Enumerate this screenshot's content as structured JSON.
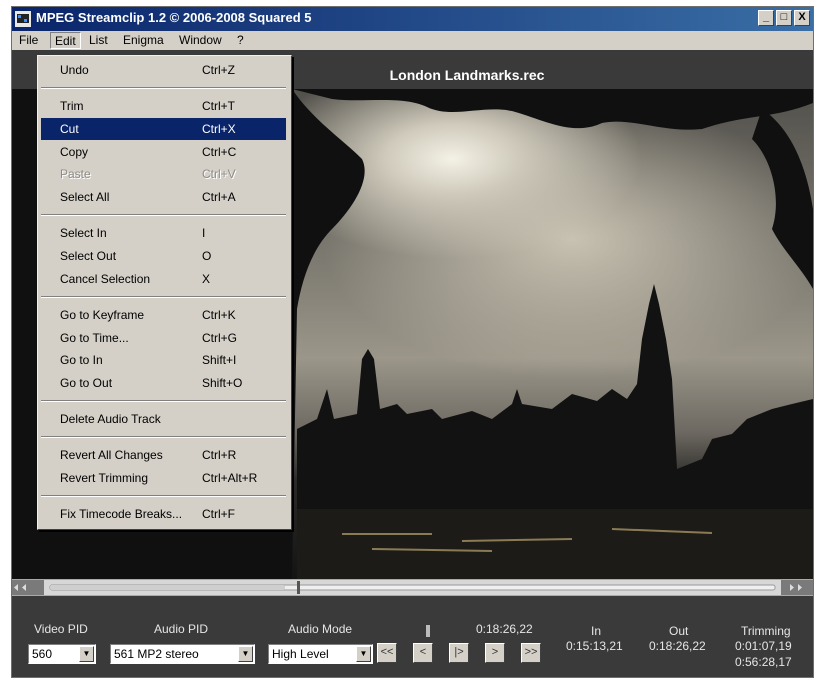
{
  "window": {
    "title": "MPEG Streamclip 1.2  ©  2006-2008 Squared 5",
    "buttons": [
      "_",
      "□",
      "X"
    ]
  },
  "menubar": [
    "File",
    "Edit",
    "List",
    "Enigma",
    "Window",
    "?"
  ],
  "file_title": "London Landmarks.rec",
  "edit_menu": {
    "groups": [
      [
        {
          "label": "Undo",
          "shortcut": "Ctrl+Z"
        }
      ],
      [
        {
          "label": "Trim",
          "shortcut": "Ctrl+T"
        },
        {
          "label": "Cut",
          "shortcut": "Ctrl+X",
          "highlighted": true
        },
        {
          "label": "Copy",
          "shortcut": "Ctrl+C"
        },
        {
          "label": "Paste",
          "shortcut": "Ctrl+V",
          "disabled": true
        },
        {
          "label": "Select All",
          "shortcut": "Ctrl+A"
        }
      ],
      [
        {
          "label": "Select In",
          "shortcut": "I"
        },
        {
          "label": "Select Out",
          "shortcut": "O"
        },
        {
          "label": "Cancel Selection",
          "shortcut": "X"
        }
      ],
      [
        {
          "label": "Go to Keyframe",
          "shortcut": "Ctrl+K"
        },
        {
          "label": "Go to Time...",
          "shortcut": "Ctrl+G"
        },
        {
          "label": "Go to In",
          "shortcut": "Shift+I"
        },
        {
          "label": "Go to Out",
          "shortcut": "Shift+O"
        }
      ],
      [
        {
          "label": "Delete Audio Track",
          "shortcut": ""
        }
      ],
      [
        {
          "label": "Revert All Changes",
          "shortcut": "Ctrl+R"
        },
        {
          "label": "Revert Trimming",
          "shortcut": "Ctrl+Alt+R"
        }
      ],
      [
        {
          "label": "Fix Timecode Breaks...",
          "shortcut": "Ctrl+F"
        }
      ]
    ]
  },
  "controls": {
    "video_pid": {
      "label": "Video PID",
      "value": "560"
    },
    "audio_pid": {
      "label": "Audio PID",
      "value": "561 MP2 stereo"
    },
    "audio_mode": {
      "label": "Audio Mode",
      "value": "High Level"
    },
    "current_time": "0:18:26,22",
    "in": {
      "label": "In",
      "value": "0:15:13,21"
    },
    "out": {
      "label": "Out",
      "value": "0:18:26,22"
    },
    "trimming": {
      "label": "Trimming",
      "value1": "0:01:07,19",
      "value2": "0:56:28,17"
    },
    "transport_buttons": [
      "<<",
      "<",
      "|>",
      ">",
      ">>"
    ],
    "playhead_position": 0.34
  },
  "colors": {
    "titlebar": "#0a246a",
    "menu_highlight": "#0a246a",
    "panel": "#3a3a3a"
  }
}
